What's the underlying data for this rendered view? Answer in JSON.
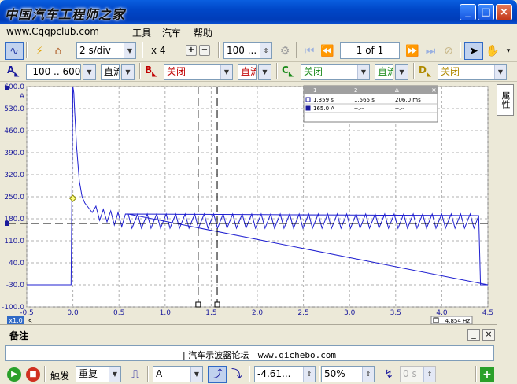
{
  "window": {
    "title": "中国汽车工程师之家"
  },
  "menu": {
    "items": [
      "www.Cqqpclub.com",
      "工具",
      "汽车",
      "帮助"
    ]
  },
  "toolbar": {
    "timebase": "2 s/div",
    "zoom": "x 4",
    "samples": "100 ...",
    "page": "1 of 1"
  },
  "channels": {
    "a": {
      "label": "A",
      "range": "-100 .. 600 A",
      "coupling": "直流"
    },
    "b": {
      "label": "B",
      "range": "关闭",
      "coupling": "直流"
    },
    "c": {
      "label": "C",
      "range": "关闭",
      "coupling": "直流"
    },
    "d": {
      "label": "D",
      "range": "关闭"
    }
  },
  "right_tab": {
    "label": "属性"
  },
  "measure_table": {
    "headers": [
      "1",
      "2",
      "Δ"
    ],
    "rows": [
      [
        "1.359 s",
        "1.565 s",
        "206.0 ms"
      ],
      [
        "165.0 A",
        "--.--",
        "--.--"
      ]
    ]
  },
  "chart_data": {
    "type": "line",
    "ylabel": "A",
    "xlabel": "s",
    "xlim": [
      -0.5,
      4.5
    ],
    "ylim": [
      -100,
      600
    ],
    "yticks": [
      "600.0",
      "530.0",
      "460.0",
      "390.0",
      "320.0",
      "250.0",
      "180.0",
      "110.0",
      "40.0",
      "-30.0",
      "-100.0"
    ],
    "xticks": [
      "-0.5",
      "0.0",
      "0.5",
      "1.0",
      "1.5",
      "2.0",
      "2.5",
      "3.0",
      "3.5",
      "4.0",
      "4.5"
    ],
    "x_multiplier": "x1.0",
    "frequency_readout": "4.854 Hz",
    "cursors_x": [
      1.359,
      1.565
    ],
    "reference_level": 165.0,
    "trigger_point": [
      0.0,
      245.0
    ],
    "series": [
      {
        "name": "A",
        "color": "#1f1fd0",
        "x": [
          -0.5,
          -0.02,
          0.0,
          0.01,
          0.02,
          0.04,
          0.07,
          0.1,
          0.13,
          0.17,
          0.21,
          0.25,
          0.29,
          0.33,
          0.37,
          0.41,
          0.45,
          0.49,
          0.53,
          0.57,
          4.4,
          4.42,
          4.5
        ],
        "y": [
          -30,
          -30,
          600,
          580,
          520,
          410,
          300,
          250,
          230,
          215,
          200,
          220,
          175,
          210,
          170,
          205,
          160,
          200,
          155,
          195,
          190,
          -30,
          -30
        ]
      }
    ],
    "ripple": {
      "start": 0.6,
      "end": 4.4,
      "period": 0.103,
      "min": 150,
      "max": 195
    }
  },
  "notes": {
    "header": "备注",
    "text": "汽车示波器论坛",
    "url": "www.qichebo.com"
  },
  "bottombar": {
    "trigger_label": "触发",
    "mode": "重复",
    "source": "A",
    "level": "-4.61...",
    "pretrigger": "50%",
    "delay": "0 s"
  },
  "colors": {
    "trace": "#1f1fd0",
    "accent": "#316ac5",
    "plot_bg": "#ffffff",
    "grid": "#b0b0b0"
  }
}
